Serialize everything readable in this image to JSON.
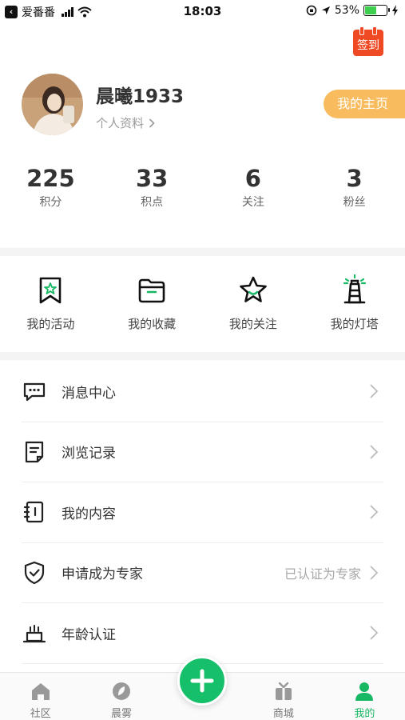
{
  "status_bar": {
    "carrier": "爱番番",
    "time": "18:03",
    "battery_percent": "53%",
    "battery_level": 0.53
  },
  "header": {
    "signin_label": "签到"
  },
  "profile": {
    "username": "晨曦1933",
    "profile_link": "个人资料",
    "homepage_button": "我的主页"
  },
  "stats": [
    {
      "value": "225",
      "label": "积分"
    },
    {
      "value": "33",
      "label": "积点"
    },
    {
      "value": "6",
      "label": "关注"
    },
    {
      "value": "3",
      "label": "粉丝"
    }
  ],
  "quick_actions": [
    {
      "label": "我的活动",
      "icon": "bookmark-star-icon"
    },
    {
      "label": "我的收藏",
      "icon": "folder-icon"
    },
    {
      "label": "我的关注",
      "icon": "star-smile-icon"
    },
    {
      "label": "我的灯塔",
      "icon": "lighthouse-icon"
    }
  ],
  "menu": [
    {
      "label": "消息中心",
      "icon": "message-icon",
      "extra": ""
    },
    {
      "label": "浏览记录",
      "icon": "document-icon",
      "extra": ""
    },
    {
      "label": "我的内容",
      "icon": "notebook-icon",
      "extra": ""
    },
    {
      "label": "申请成为专家",
      "icon": "shield-check-icon",
      "extra": "已认证为专家"
    },
    {
      "label": "年龄认证",
      "icon": "cake-icon",
      "extra": ""
    }
  ],
  "tabbar": [
    {
      "label": "社区",
      "icon": "home-icon",
      "active": false
    },
    {
      "label": "晨雾",
      "icon": "leaf-icon",
      "active": false
    },
    {
      "label": "",
      "icon": "plus-icon",
      "active": false
    },
    {
      "label": "商城",
      "icon": "gift-icon",
      "active": false
    },
    {
      "label": "我的",
      "icon": "user-icon",
      "active": true
    }
  ],
  "colors": {
    "accent_green": "#17b863",
    "homepage_orange": "#f8bc5e",
    "signin_red": "#ef4a24"
  }
}
